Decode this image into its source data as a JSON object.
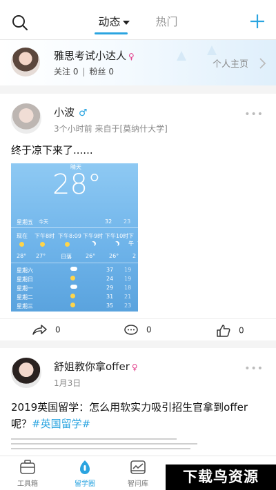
{
  "header": {
    "search_icon": "search-icon",
    "tabs": [
      {
        "label": "动态",
        "active": true
      },
      {
        "label": "热门",
        "active": false
      }
    ],
    "plus_icon": "plus-icon",
    "accent": "#2aa4e0"
  },
  "profile": {
    "name": "雅思考试小达人",
    "gender_symbol": "♀",
    "following_label": "关注 0",
    "separator": "|",
    "fans_label": "粉丝 0",
    "home_link": "个人主页"
  },
  "posts": [
    {
      "username": "小波",
      "gender_symbol": "♂",
      "meta": "3个小时前 来自于[莫纳什大学]",
      "more": "•••",
      "content": "终于凉下来了......",
      "image": {
        "sky_label": "晴天",
        "temperature": "28°",
        "today_row": {
          "day": "星期五",
          "today": "今天",
          "high": "32",
          "low": "23"
        },
        "hour_labels": [
          "现在",
          "下午8时",
          "下午8:09",
          "下午9时",
          "下午10时",
          "下午"
        ],
        "hour_temps": [
          "28°",
          "27°",
          "日落",
          "26°",
          "26°",
          "2"
        ],
        "forecast": [
          {
            "day": "星期六",
            "high": "37",
            "low": "19"
          },
          {
            "day": "星期日",
            "high": "24",
            "low": "19"
          },
          {
            "day": "星期一",
            "high": "29",
            "low": "18"
          },
          {
            "day": "星期二",
            "high": "31",
            "low": "21"
          },
          {
            "day": "星期三",
            "high": "35",
            "low": "23"
          }
        ]
      },
      "share_count": "0",
      "comment_count": "0",
      "like_count": "0"
    },
    {
      "username": "舒姐教你拿offer",
      "gender_symbol": "♀",
      "meta": "1月3日",
      "more": "•••",
      "content_text": "2019英国留学：怎么用软实力吸引招生官拿到offer呢？",
      "hashtag": "#英国留学#"
    }
  ],
  "tabbar": {
    "items": [
      {
        "label": "工具箱",
        "icon": "toolbox-icon",
        "active": false
      },
      {
        "label": "留学圈",
        "icon": "circle-icon",
        "active": true
      },
      {
        "label": "智问库",
        "icon": "qa-library-icon",
        "active": false
      }
    ]
  },
  "watermark": "下载鸟资源"
}
